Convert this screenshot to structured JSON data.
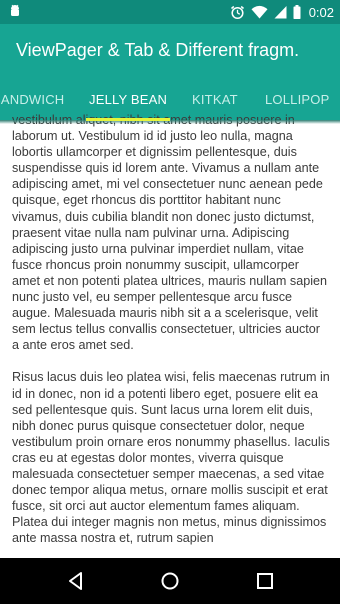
{
  "status_bar": {
    "time": "0:02",
    "left_icon": "android-icon",
    "icons": [
      "alarm-icon",
      "wifi-icon",
      "signal-icon",
      "battery-icon"
    ]
  },
  "app_bar": {
    "title": "ViewPager & Tab & Different fragm."
  },
  "tabs": [
    {
      "label": "Sandwich",
      "active": false
    },
    {
      "label": "Jelly Bean",
      "active": true
    },
    {
      "label": "KitKat",
      "active": false
    },
    {
      "label": "Lollipop",
      "active": false
    }
  ],
  "content": {
    "paragraphs": [
      "vestibulum aliquet, nibh sit amet mauris posuere in laborum ut. Vestibulum id id justo leo nulla, magna lobortis ullamcorper et dignissim pellentesque, duis suspendisse quis id lorem ante. Vivamus a nullam ante adipiscing amet, mi vel consectetuer nunc aenean pede quisque, eget rhoncus dis porttitor habitant nunc vivamus, duis cubilia blandit non donec justo dictumst, praesent vitae nulla nam pulvinar urna. Adipiscing adipiscing justo urna pulvinar imperdiet nullam, vitae fusce rhoncus proin nonummy suscipit, ullamcorper amet et non potenti platea ultrices, mauris nullam sapien nunc justo vel, eu semper pellentesque arcu fusce augue. Malesuada mauris nibh sit a a scelerisque, velit sem lectus tellus convallis consectetuer, ultricies auctor a ante eros amet sed.",
      " Risus lacus duis leo platea wisi, felis maecenas rutrum in id in donec, non id a potenti libero eget, posuere elit ea sed pellentesque quis. Sunt lacus urna lorem elit duis, nibh donec purus quisque consectetuer dolor, neque vestibulum proin ornare eros nonummy phasellus. Iaculis cras eu at egestas dolor montes, viverra quisque malesuada consectetuer semper maecenas, a sed vitae donec tempor aliqua metus, ornare mollis suscipit et erat fusce, sit orci aut auctor elementum fames aliquam. Platea dui integer magnis non metus, minus dignissimos ante massa nostra et, rutrum sapien"
    ]
  },
  "nav_bar": {
    "icons": [
      "back-icon",
      "home-icon",
      "recents-icon"
    ]
  },
  "colors": {
    "status_bar": "#0f8a7b",
    "primary": "#17a593",
    "indicator": "#e6f53b",
    "text": "#3b3b3b"
  }
}
